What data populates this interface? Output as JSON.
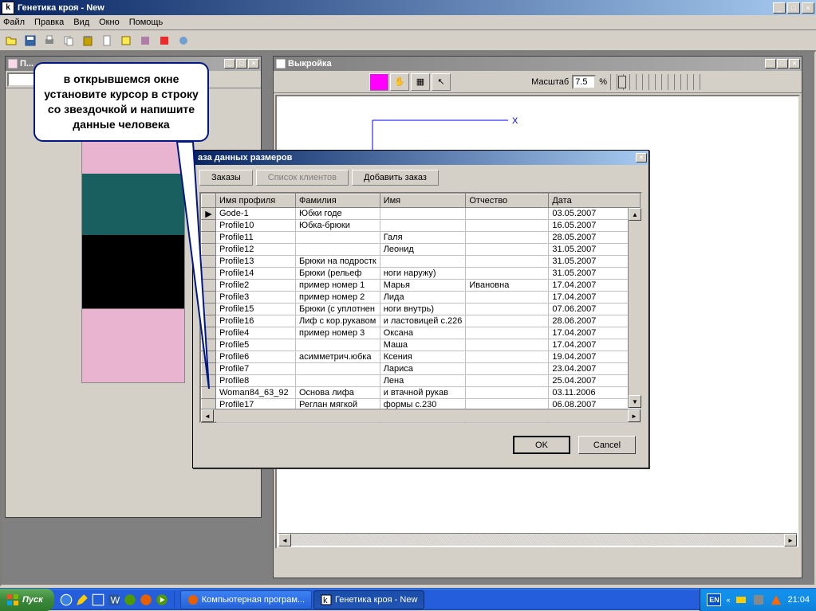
{
  "main": {
    "title": "Генетика кроя - New",
    "menus": [
      "Файл",
      "Правка",
      "Вид",
      "Окно",
      "Помощь"
    ]
  },
  "left_window": {
    "title": "П..."
  },
  "right_window": {
    "title": "Выкройка",
    "scale_label": "Масштаб",
    "scale_value": "7.5",
    "scale_pct": "%"
  },
  "dialog": {
    "title": "аза данных размеров",
    "tabs": {
      "orders": "Заказы",
      "clients": "Список клиентов",
      "add": "Добавить заказ"
    },
    "columns": [
      "Имя профиля",
      "Фамилия",
      "Имя",
      "Отчество",
      "Дата"
    ],
    "rows": [
      {
        "p": "Gode-1",
        "f": "Юбки годе",
        "i": "",
        "o": "",
        "d": "03.05.2007"
      },
      {
        "p": "Profile10",
        "f": "Юбка-брюки",
        "i": "",
        "o": "",
        "d": "16.05.2007"
      },
      {
        "p": "Profile11",
        "f": "",
        "i": "Галя",
        "o": "",
        "d": "28.05.2007"
      },
      {
        "p": "Profile12",
        "f": "",
        "i": "Леонид",
        "o": "",
        "d": "31.05.2007"
      },
      {
        "p": "Profile13",
        "f": "Брюки на подростк",
        "i": "",
        "o": "",
        "d": "31.05.2007"
      },
      {
        "p": "Profile14",
        "f": "Брюки    (рельеф",
        "i": "ноги наружу)",
        "o": "",
        "d": "31.05.2007"
      },
      {
        "p": "Profile2",
        "f": "пример номер 1",
        "i": "Марья",
        "o": "Ивановна",
        "d": "17.04.2007"
      },
      {
        "p": "Profile3",
        "f": "пример номер 2",
        "i": "Лида",
        "o": "",
        "d": "17.04.2007"
      },
      {
        "p": "Profile15",
        "f": "Брюки (с уплотнен",
        "i": "ноги внутрь)",
        "o": "",
        "d": "07.06.2007"
      },
      {
        "p": "Profile16",
        "f": "Лиф с кор.рукавом",
        "i": "и ластовицей с.226",
        "o": "",
        "d": "28.06.2007"
      },
      {
        "p": "Profile4",
        "f": "пример номер 3",
        "i": "Оксана",
        "o": "",
        "d": "17.04.2007"
      },
      {
        "p": "Profile5",
        "f": "",
        "i": "Маша",
        "o": "",
        "d": "17.04.2007"
      },
      {
        "p": "Profile6",
        "f": "асимметрич.юбка",
        "i": "Ксения",
        "o": "",
        "d": "19.04.2007"
      },
      {
        "p": "Profile7",
        "f": "",
        "i": "Лариса",
        "o": "",
        "d": "23.04.2007"
      },
      {
        "p": "Profile8",
        "f": "",
        "i": "Лена",
        "o": "",
        "d": "25.04.2007"
      },
      {
        "p": "Woman84_63_92",
        "f": "Основа лифа",
        "i": "и втачной рукав",
        "o": "",
        "d": "03.11.2006"
      },
      {
        "p": "Profile17",
        "f": "Реглан мягкой",
        "i": "формы с.230",
        "o": "",
        "d": "06.08.2007"
      }
    ],
    "star": "*",
    "ok": "OK",
    "cancel": "Cancel"
  },
  "callout": {
    "text": "в открывшемся окне установите курсор в строку со звездочкой и напишите данные человека"
  },
  "taskbar": {
    "start": "Пуск",
    "tasks": [
      {
        "label": "Компьютерная програм...",
        "active": false
      },
      {
        "label": "Генетика кроя - New",
        "active": true
      }
    ],
    "lang": "EN",
    "clock": "21:04"
  }
}
